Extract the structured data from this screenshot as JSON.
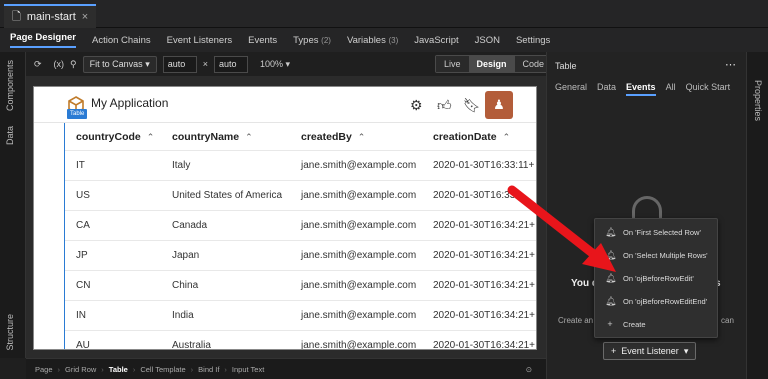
{
  "file_tab": {
    "label": "main-start",
    "close": "×"
  },
  "topnav": {
    "items": [
      "Page Designer",
      "Action Chains",
      "Event Listeners",
      "Events"
    ],
    "types_label": "Types",
    "types_count": "(2)",
    "variables_label": "Variables",
    "variables_count": "(3)",
    "tail_items": [
      "JavaScript",
      "JSON",
      "Settings"
    ]
  },
  "left_rail": {
    "components": "Components",
    "data": "Data",
    "structure": "Structure"
  },
  "toolbar": {
    "fit": "Fit to Canvas",
    "width": "auto",
    "times": "×",
    "height": "auto",
    "zoom": "100%",
    "modes": [
      "Live",
      "Design",
      "Code"
    ],
    "active_mode": "Design"
  },
  "app": {
    "title": "My Application",
    "badge": "Table",
    "avatar_glyph": "♟"
  },
  "table": {
    "columns": [
      "countryCode",
      "countryName",
      "createdBy",
      "creationDate"
    ],
    "sort_glyph": "⌃",
    "rows": [
      [
        "IT",
        "Italy",
        "jane.smith@example.com",
        "2020-01-30T16:33:11+"
      ],
      [
        "US",
        "United States of America",
        "jane.smith@example.com",
        "2020-01-30T16:33"
      ],
      [
        "CA",
        "Canada",
        "jane.smith@example.com",
        "2020-01-30T16:34:21+"
      ],
      [
        "JP",
        "Japan",
        "jane.smith@example.com",
        "2020-01-30T16:34:21+"
      ],
      [
        "CN",
        "China",
        "jane.smith@example.com",
        "2020-01-30T16:34:21+"
      ],
      [
        "IN",
        "India",
        "jane.smith@example.com",
        "2020-01-30T16:34:21+"
      ],
      [
        "AU",
        "Australia",
        "jane.smith@example.com",
        "2020-01-30T16:34:21+"
      ]
    ]
  },
  "breadcrumb": [
    "Page",
    "Grid Row",
    "Table",
    "Cell Template",
    "Bind If",
    "Input Text"
  ],
  "breadcrumb_active": "Table",
  "right_panel": {
    "title": "Table",
    "more": "⋯",
    "tabs": [
      "General",
      "Data",
      "Events",
      "All",
      "Quick Start"
    ],
    "active_tab": "Events",
    "partial_heading_left": "You do",
    "partial_heading_right": "s",
    "partial_text_left": "Create an ev",
    "partial_text_right": "can",
    "add_button": "Event Listener"
  },
  "right_rail": {
    "properties": "Properties"
  },
  "menu": {
    "items": [
      {
        "icon": "bell-icon",
        "label": "On 'First Selected Row'"
      },
      {
        "icon": "bell-icon",
        "label": "On 'Select Multiple Rows'"
      },
      {
        "icon": "bell-icon",
        "label": "On 'ojBeforeRowEdit'"
      },
      {
        "icon": "bell-icon",
        "label": "On 'ojBeforeRowEditEnd'"
      },
      {
        "icon": "plus-icon",
        "label": "Create"
      }
    ]
  },
  "colors": {
    "accent": "#5aa0ff",
    "avatar": "#b35d3a",
    "arrow": "#e8151b"
  }
}
